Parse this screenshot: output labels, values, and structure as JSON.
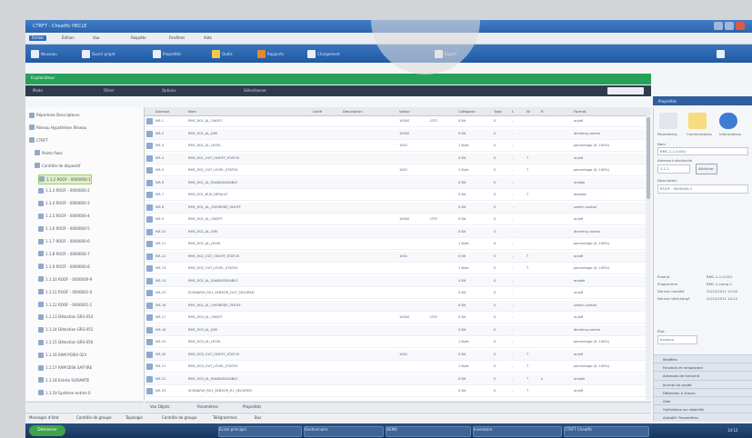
{
  "window": {
    "title": "CTRFT - Cheatfic HECLE"
  },
  "menu": [
    "Fichier",
    "Édition",
    "Vue",
    "Requête",
    "Fenêtres",
    "Aide"
  ],
  "toolbar": {
    "items": [
      "Nouveau",
      "Ouvrir projet",
      "Propriétés",
      "Outils",
      "Rapports",
      "Chargement",
      "Export"
    ]
  },
  "green_bar": {
    "title": "Explorateur"
  },
  "subtoolbar": {
    "items": [
      "Mode",
      "Filtrer",
      "Options",
      "Sélectionner"
    ]
  },
  "tree": {
    "items": [
      "Répertoire Descripteurs",
      "Réseau Hypothèses Réseau",
      "CTRFT",
      "Points fixes",
      "Contrôle de dispositif",
      "1.1.2 ROOF - 0000000-1",
      "1.1.3 ROOF - 0000000-2",
      "1.1.4 ROOF - 0000000-3",
      "1.1.5 ROOF - 0000000-4",
      "1.1.6 ROOF - 0000000-5",
      "1.1.7 ROOF - 0000000-6",
      "1.1.8 ROOF - 0000000-7",
      "1.1.9 ROOF - 0000000-8",
      "1.1.10 ROOF - 0000000-9",
      "1.1.11 ROOF - 0000001-0",
      "1.1.12 ROOF - 0000001-1",
      "1.1.13 Détection GRS-054",
      "1.1.14 Détection GRS-055",
      "1.1.15 Détection GRS-056",
      "1.1.16 RAM POSIX 024",
      "1.1.17 RAM DISK SAFFIRE",
      "1.1.18 Entrée SUIVANTE",
      "1.1.19 Système entrée 0"
    ]
  },
  "grid": {
    "headers": [
      "",
      "Adresse",
      "Nom",
      "Unité",
      "Description",
      "Valeur",
      "Catégorie",
      "Type",
      "L",
      "W",
      "R",
      "Format"
    ],
    "rows": [
      [
        "MĂ 1",
        "RMC_R01_AL_ONOFF",
        "10000",
        "LT0T",
        "0 Bit",
        "0",
        "-",
        "",
        "",
        "on/off"
      ],
      [
        "MĂ 2",
        "RMC_R01_AL_DIM",
        "10000",
        "",
        "0 Bit",
        "0",
        "-",
        "",
        "",
        "dimming control"
      ],
      [
        "MĂ 3",
        "RMC_R01_AL_LEVEL",
        "1001",
        "",
        "1 Byte",
        "0",
        "-",
        "",
        "",
        "percentage (0..100%)"
      ],
      [
        "MĂ 4",
        "RMC_R01_OUT_ONOFF_STATUS",
        "",
        "",
        "0 Bit",
        "0",
        "-",
        "T",
        "",
        "on/off"
      ],
      [
        "MĂ 5",
        "RMC_R01_OUT_LEVEL_STATUS",
        "1001",
        "",
        "1 Byte",
        "0",
        "-",
        "T",
        "",
        "percentage (0..100%)"
      ],
      [
        "MĂ 6",
        "RMC_R01_AL_ENABLEDISABLE",
        "",
        "",
        "0 Bit",
        "0",
        "-",
        "",
        "",
        "enable"
      ],
      [
        "MĂ 7",
        "RMC_R01_BUS_DEFAULT",
        "",
        "",
        "0 Bit",
        "0",
        "-",
        "T",
        "",
        "boolean"
      ],
      [
        "MĂ 8",
        "RMC_R01_AL_OVERRIDE_ONOFF",
        "",
        "",
        "0 Bit",
        "0",
        "-",
        "",
        "",
        "switch control"
      ],
      [
        "MĂ 9",
        "RMC_R02_AL_ONOFF",
        "10000",
        "LT0T",
        "0 Bit",
        "0",
        "-",
        "",
        "",
        "on/off"
      ],
      [
        "MĂ 10",
        "RMC_R02_AL_DIM",
        "",
        "",
        "0 Bit",
        "0",
        "-",
        "",
        "",
        "dimming control"
      ],
      [
        "MĂ 11",
        "RMC_R02_AL_LEVEL",
        "",
        "",
        "1 Byte",
        "0",
        "-",
        "",
        "",
        "percentage (0..100%)"
      ],
      [
        "MĂ 12",
        "RMC_R02_OUT_ONOFF_STATUS",
        "1001",
        "",
        "0 Bit",
        "0",
        "-",
        "T",
        "",
        "on/off"
      ],
      [
        "MĂ 13",
        "RMC_R02_OUT_LEVEL_STATUS",
        "",
        "",
        "1 Byte",
        "0",
        "-",
        "T",
        "",
        "percentage (0..100%)"
      ],
      [
        "MĂ 14",
        "RMC_R02_AL_ENABLEDISABLE",
        "",
        "",
        "0 Bit",
        "0",
        "-",
        "",
        "",
        "enable"
      ],
      [
        "MĂ 15",
        "SCENARIO_R01_SENSOR_OUT_SECURED",
        "",
        "",
        "0 Bit",
        "0",
        "-",
        "",
        "",
        "on/off"
      ],
      [
        "MĂ 16",
        "RMC_R02_AL_OVERRIDE_ONOFF",
        "",
        "",
        "0 Bit",
        "0",
        "-",
        "",
        "",
        "switch control"
      ],
      [
        "MĂ 17",
        "RMC_R03_AL_ONOFF",
        "10000",
        "LT0T",
        "0 Bit",
        "0",
        "-",
        "",
        "",
        "on/off"
      ],
      [
        "MĂ 18",
        "RMC_R03_AL_DIM",
        "",
        "",
        "0 Bit",
        "0",
        "-",
        "",
        "",
        "dimming control"
      ],
      [
        "MĂ 19",
        "RMC_R03_AL_LEVEL",
        "",
        "",
        "1 Byte",
        "0",
        "-",
        "",
        "",
        "percentage (0..100%)"
      ],
      [
        "MĂ 20",
        "RMC_R03_OUT_ONOFF_STATUS",
        "1001",
        "",
        "0 Bit",
        "0",
        "-",
        "T",
        "",
        "on/off"
      ],
      [
        "MĂ 21",
        "RMC_R03_OUT_LEVEL_STATUS",
        "",
        "",
        "1 Byte",
        "0",
        "-",
        "T",
        "",
        "percentage (0..100%)"
      ],
      [
        "MĂ 22",
        "RMC_R03_AL_ENABLEDISABLE",
        "",
        "",
        "0 Bit",
        "0",
        "-",
        "T",
        "V",
        "enable"
      ],
      [
        "MĂ 23",
        "SCENARIO_R01_SENSOR_R1_SECURED",
        "",
        "",
        "0 Bit",
        "0",
        "-",
        "T",
        "",
        "on/off"
      ]
    ]
  },
  "bottom_tabs": [
    "Vue Objets",
    "Paramètres",
    "Propriétés"
  ],
  "status": {
    "tabs": [
      "Messages d'état",
      "Contrôle de groupe",
      "Topologie",
      "Contrôle de groupe",
      "Télégrammes",
      "Bus"
    ]
  },
  "props": {
    "header": "Propriétés",
    "tabs": [
      "Paramètres",
      "Commentaires",
      "Informations"
    ],
    "labels": [
      "Nom",
      "RMC-1-1.0-001",
      "Adresse individuelle",
      "1.1.1",
      "Attribuer",
      "Description",
      "ROOF - 0000000-1"
    ],
    "meta": [
      [
        "Produit",
        "RMC-1-1.0-001"
      ],
      [
        "Programme",
        "RMC-1-comp-1"
      ],
      [
        "Dernier modifié",
        "22/12/2011 12:00"
      ],
      [
        "Dernier téléchargé",
        "22/12/2011 14:12"
      ]
    ],
    "state_label": "État",
    "state_value": "Inconnu",
    "accordions": [
      "Modèles",
      "Fonction et remplaçant",
      "Adresses de transmit",
      "Journal du projet",
      "Détection & traces",
      "Aide",
      "Opérations sur objectifs",
      "Autodiff. Paramètres"
    ]
  },
  "taskbar": {
    "start": "Démarrer",
    "buttons": [
      "Ecran principal",
      "Gestionnaire",
      "DEMO",
      "Inventaire",
      "CTRFT Cheatfic"
    ],
    "time": "14:12"
  },
  "colors": {
    "green": "#27a05a",
    "blue": "#2f6db8",
    "dark": "#2f3b4c"
  }
}
